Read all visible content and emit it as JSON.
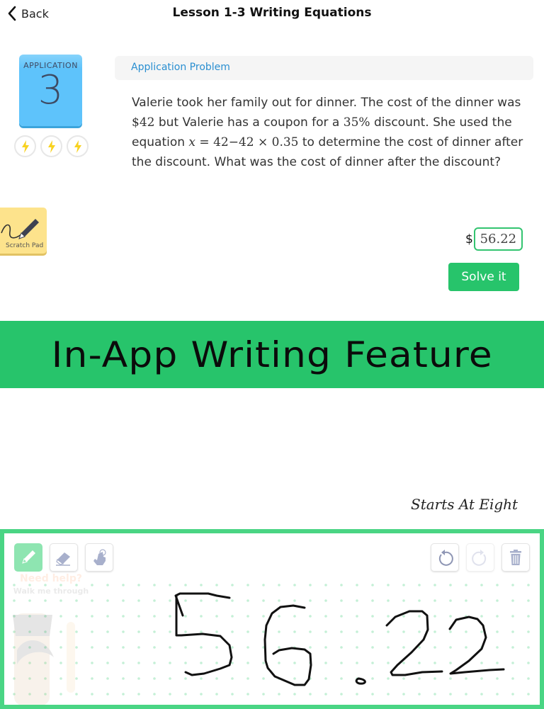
{
  "header": {
    "back_label": "Back",
    "title": "Lesson 1-3 Writing Equations"
  },
  "badge": {
    "label": "APPLICATION",
    "number": "3",
    "stars_total": 3,
    "stars_icon": "lightning-icon"
  },
  "problem": {
    "section_label": "Application Problem",
    "text_parts": {
      "p1": "Valerie took her family out for dinner. The cost of the dinner was ",
      "m1": "$42",
      "p2": " but Valerie has a coupon for a ",
      "m2": "35%",
      "p3": " discount. She used the equation ",
      "m3_var": "x",
      "m3_rest": " = 42−42 × 0.35",
      "p4": " to determine the cost of dinner after the discount. What was the cost of dinner after the discount?"
    }
  },
  "scratch_pad": {
    "label": "Scratch Pad"
  },
  "answer": {
    "prefix": "$",
    "value": "56.22",
    "submit_label": "Solve it"
  },
  "banner": {
    "text": "In-App Writing Feature"
  },
  "watermark": {
    "text": "Starts At Eight"
  },
  "writing_pad": {
    "tools": [
      "pencil",
      "eraser",
      "pointer"
    ],
    "active_tool": "pencil",
    "actions": [
      "undo",
      "redo",
      "clear"
    ],
    "redo_enabled": false,
    "helper_title": "Need help?",
    "helper_subtitle": "Walk me through",
    "handwritten_value": "56.22",
    "colors": {
      "border": "#4ad584",
      "dots": "#c4f0d6",
      "ink": "#111111",
      "active_tool": "#8ee5b1"
    }
  },
  "colors": {
    "accent_green": "#27c46b",
    "badge_blue": "#5ec3fb",
    "link_blue": "#2a8fd1",
    "scratch_yellow": "#fde38c"
  }
}
